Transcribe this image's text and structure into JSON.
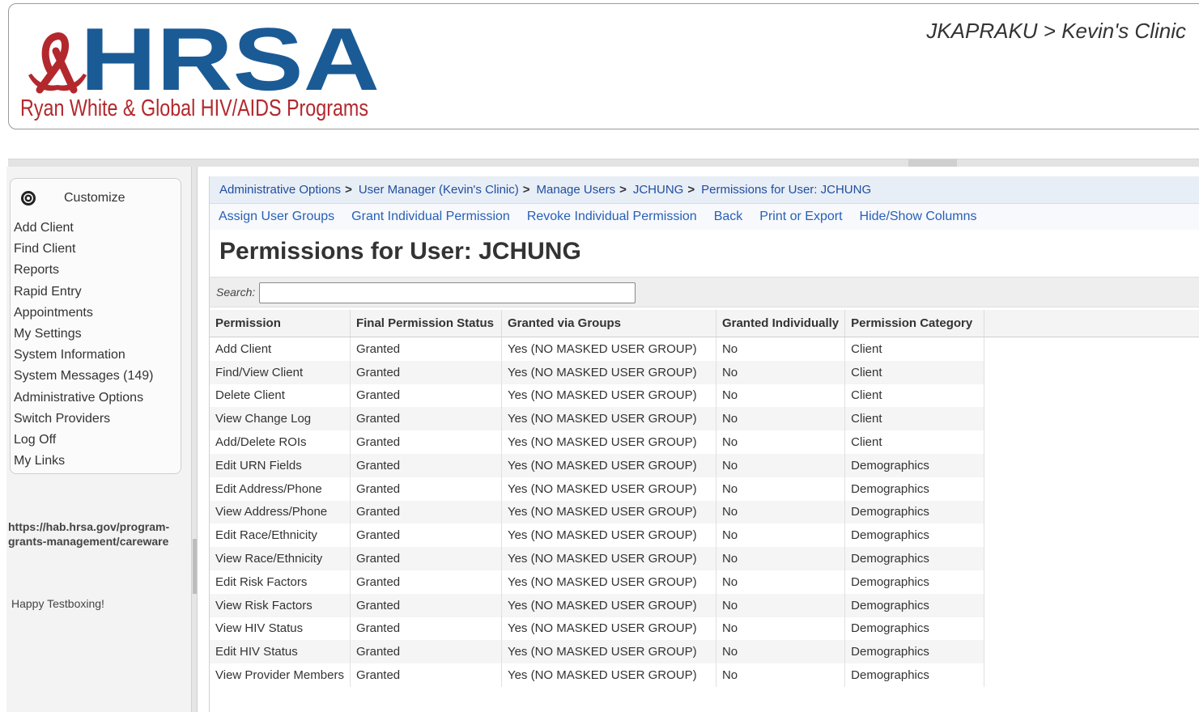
{
  "header": {
    "logo_letters": "HRSA",
    "logo_subtitle": "Ryan White & Global HIV/AIDS Programs",
    "user_context": "JKAPRAKU > Kevin's Clinic",
    "brand_blue": "#1a5b96",
    "brand_red": "#b3282d"
  },
  "sidebar": {
    "customize_label": "Customize",
    "items": [
      {
        "label": "Add Client"
      },
      {
        "label": "Find Client"
      },
      {
        "label": "Reports"
      },
      {
        "label": "Rapid Entry"
      },
      {
        "label": "Appointments"
      },
      {
        "label": "My Settings"
      },
      {
        "label": "System Information"
      },
      {
        "label": "System Messages (149)"
      },
      {
        "label": "Administrative Options"
      },
      {
        "label": "Switch Providers"
      },
      {
        "label": "Log Off"
      },
      {
        "label": "My Links"
      }
    ],
    "link_text": "https://hab.hrsa.gov/program-grants-management/careware",
    "tagline": "Happy Testboxing!"
  },
  "breadcrumb": [
    {
      "label": "Administrative Options"
    },
    {
      "label": "User Manager (Kevin's Clinic)"
    },
    {
      "label": "Manage Users"
    },
    {
      "label": "JCHUNG"
    },
    {
      "label": "Permissions for User: JCHUNG"
    }
  ],
  "actions": [
    {
      "label": "Assign User Groups"
    },
    {
      "label": "Grant Individual Permission"
    },
    {
      "label": "Revoke Individual Permission"
    },
    {
      "label": "Back"
    },
    {
      "label": "Print or Export"
    },
    {
      "label": "Hide/Show Columns"
    }
  ],
  "page_title": "Permissions for User: JCHUNG",
  "search": {
    "label": "Search:",
    "value": "",
    "placeholder": ""
  },
  "table": {
    "columns": [
      "Permission",
      "Final Permission Status",
      "Granted via Groups",
      "Granted Individually",
      "Permission Category"
    ],
    "rows": [
      [
        "Add Client",
        "Granted",
        "Yes (NO MASKED USER GROUP)",
        "No",
        "Client"
      ],
      [
        "Find/View Client",
        "Granted",
        "Yes (NO MASKED USER GROUP)",
        "No",
        "Client"
      ],
      [
        "Delete Client",
        "Granted",
        "Yes (NO MASKED USER GROUP)",
        "No",
        "Client"
      ],
      [
        "View Change Log",
        "Granted",
        "Yes (NO MASKED USER GROUP)",
        "No",
        "Client"
      ],
      [
        "Add/Delete ROIs",
        "Granted",
        "Yes (NO MASKED USER GROUP)",
        "No",
        "Client"
      ],
      [
        "Edit URN Fields",
        "Granted",
        "Yes (NO MASKED USER GROUP)",
        "No",
        "Demographics"
      ],
      [
        "Edit Address/Phone",
        "Granted",
        "Yes (NO MASKED USER GROUP)",
        "No",
        "Demographics"
      ],
      [
        "View Address/Phone",
        "Granted",
        "Yes (NO MASKED USER GROUP)",
        "No",
        "Demographics"
      ],
      [
        "Edit Race/Ethnicity",
        "Granted",
        "Yes (NO MASKED USER GROUP)",
        "No",
        "Demographics"
      ],
      [
        "View Race/Ethnicity",
        "Granted",
        "Yes (NO MASKED USER GROUP)",
        "No",
        "Demographics"
      ],
      [
        "Edit Risk Factors",
        "Granted",
        "Yes (NO MASKED USER GROUP)",
        "No",
        "Demographics"
      ],
      [
        "View Risk Factors",
        "Granted",
        "Yes (NO MASKED USER GROUP)",
        "No",
        "Demographics"
      ],
      [
        "View HIV Status",
        "Granted",
        "Yes (NO MASKED USER GROUP)",
        "No",
        "Demographics"
      ],
      [
        "Edit HIV Status",
        "Granted",
        "Yes (NO MASKED USER GROUP)",
        "No",
        "Demographics"
      ],
      [
        "View Provider Members",
        "Granted",
        "Yes (NO MASKED USER GROUP)",
        "No",
        "Demographics"
      ]
    ]
  }
}
